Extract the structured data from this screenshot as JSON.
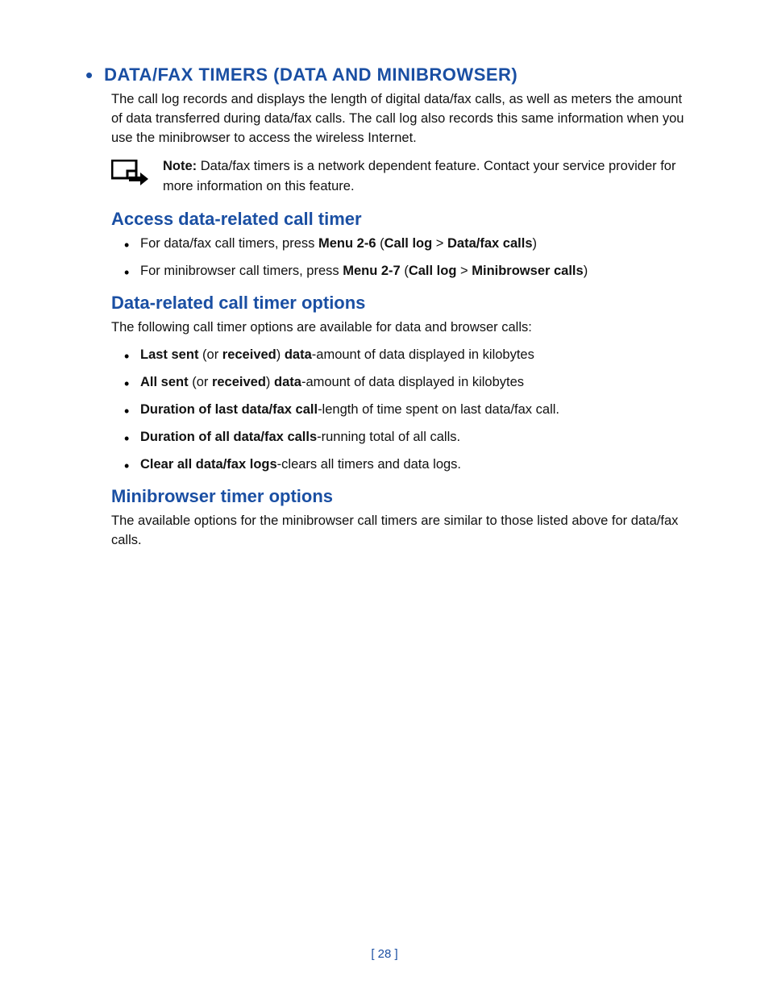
{
  "heading": "DATA/FAX TIMERS (DATA AND MINIBROWSER)",
  "intro": "The call log records and displays the length of digital data/fax calls, as well as meters the amount of data transferred during data/fax calls. The call log also records this same information when you use the minibrowser to access the wireless Internet.",
  "note_label": "Note:",
  "note_text": " Data/fax timers is a network dependent feature. Contact your service provider for more information on this feature.",
  "section1": {
    "title": "Access data-related call timer",
    "item1_pre": "For data/fax call timers, press ",
    "item1_b1": "Menu 2-6",
    "item1_mid": " (",
    "item1_b2": "Call log",
    "item1_sep": " > ",
    "item1_b3": "Data/fax calls",
    "item1_end": ")",
    "item2_pre": "For minibrowser call timers, press ",
    "item2_b1": "Menu 2-7",
    "item2_mid": " (",
    "item2_b2": "Call log",
    "item2_sep": " > ",
    "item2_b3": "Minibrowser calls",
    "item2_end": ")"
  },
  "section2": {
    "title": "Data-related call timer options",
    "intro": "The following call timer options are available for data and browser calls:",
    "i1_b1": "Last sent",
    "i1_t1": " (or ",
    "i1_b2": "received",
    "i1_t2": ") ",
    "i1_b3": "data",
    "i1_t3": "-amount of data displayed in kilobytes",
    "i2_b1": "All sent",
    "i2_t1": " (or ",
    "i2_b2": "received",
    "i2_t2": ") ",
    "i2_b3": "data",
    "i2_t3": "-amount of data displayed in kilobytes",
    "i3_b1": "Duration of last data/fax call",
    "i3_t1": "-length of time spent on last data/fax call.",
    "i4_b1": "Duration of all data/fax calls",
    "i4_t1": "-running total of all calls.",
    "i5_b1": "Clear all data/fax logs",
    "i5_t1": "-clears all timers and data logs."
  },
  "section3": {
    "title": "Minibrowser timer options",
    "text": "The available options for the minibrowser call timers are similar to those listed above for data/fax calls."
  },
  "page_number": "[ 28 ]"
}
